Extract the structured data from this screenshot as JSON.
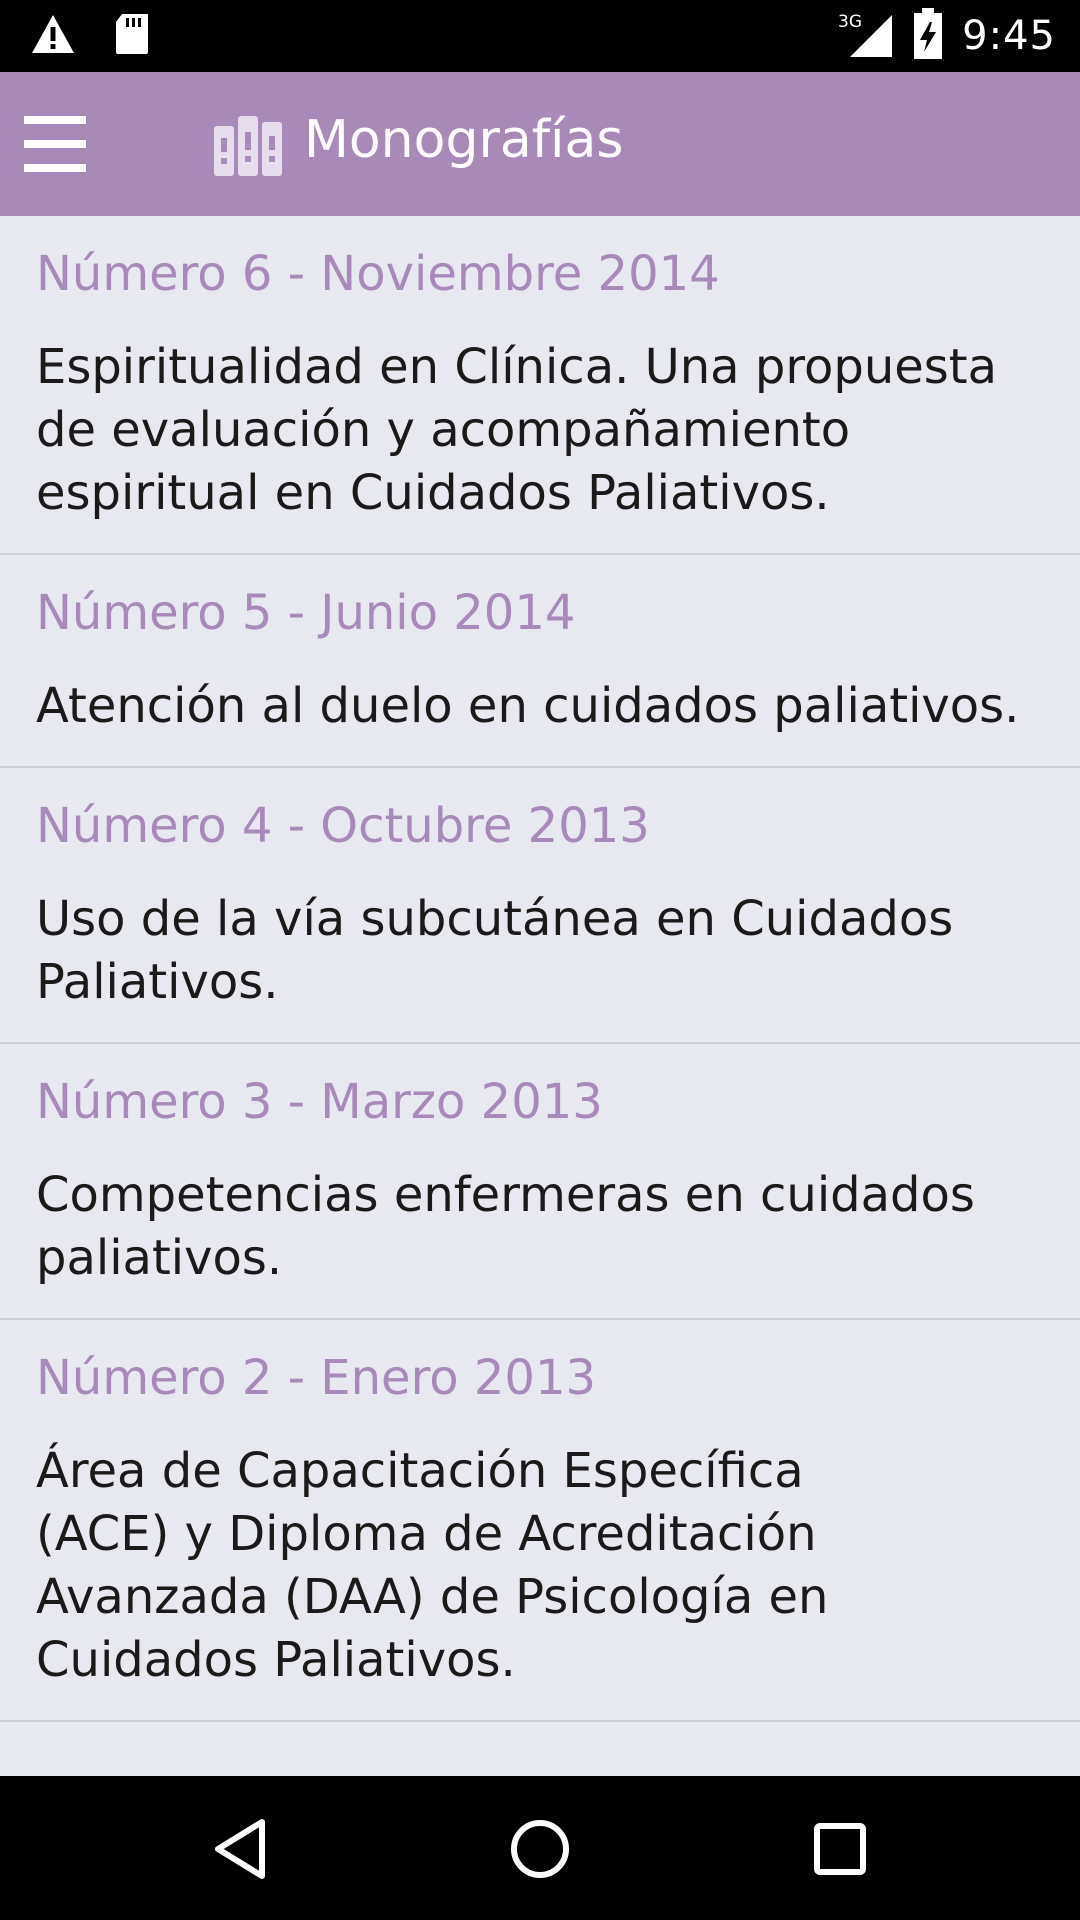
{
  "status_bar": {
    "time": "9:45",
    "network": "3G",
    "icons": [
      "warning-icon",
      "sd-card-icon",
      "signal-3g-icon",
      "battery-charging-icon"
    ]
  },
  "app_bar": {
    "title": "Monografías",
    "icons": [
      "menu-icon",
      "books-logo-icon"
    ]
  },
  "monographs": [
    {
      "number": "Número 6 - Noviembre 2014",
      "title": "Espiritualidad en Clínica. Una propuesta de evaluación y acompañamiento espiritual en Cuidados Paliativos."
    },
    {
      "number": "Número 5 - Junio 2014",
      "title": "Atención al duelo en cuidados paliativos."
    },
    {
      "number": "Número 4 - Octubre 2013",
      "title": "Uso de la vía subcutánea en Cuidados Paliativos."
    },
    {
      "number": "Número 3 - Marzo 2013",
      "title": "Competencias enfermeras en cuidados paliativos."
    },
    {
      "number": "Número 2 - Enero 2013",
      "title": "Área de Capacitación Específica (ACE) y Diploma de Acreditación Avanzada (DAA) de Psicología en Cuidados Paliativos."
    }
  ],
  "colors": {
    "accent": "#a88ab9",
    "background": "#e8e8f0",
    "text": "#1a1a1a"
  },
  "nav_bar": {
    "icons": [
      "back-icon",
      "home-icon",
      "recent-apps-icon"
    ]
  }
}
